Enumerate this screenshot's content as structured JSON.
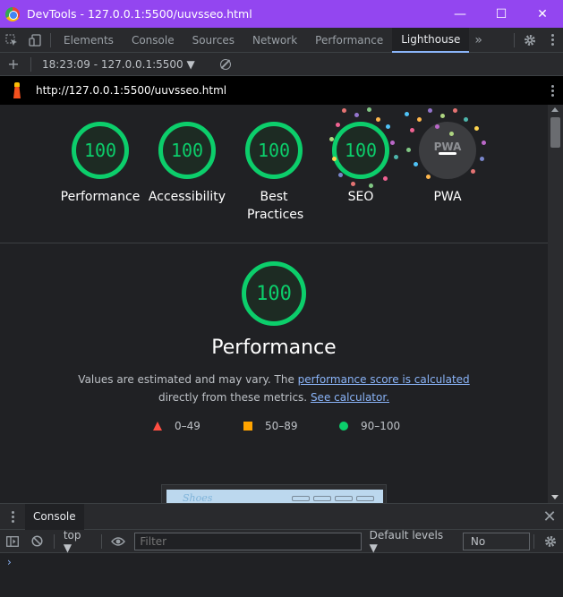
{
  "window": {
    "title": "DevTools - 127.0.0.1:5500/uuvsseo.html",
    "controls": {
      "minimize": "—",
      "maximize": "☐",
      "close": "✕"
    }
  },
  "tabs": {
    "items": [
      "Elements",
      "Console",
      "Sources",
      "Network",
      "Performance",
      "Lighthouse"
    ],
    "active": "Lighthouse",
    "more": "»"
  },
  "lighthouse_toolbar": {
    "add": "+",
    "report_select": "18:23:09 - 127.0.0.1:5500 ▼"
  },
  "urlbar": {
    "url": "http://127.0.0.1:5500/uuvsseo.html"
  },
  "gauges": [
    {
      "score": "100",
      "label": "Performance"
    },
    {
      "score": "100",
      "label": "Accessibility"
    },
    {
      "score": "100",
      "label": "Best Practices"
    },
    {
      "score": "100",
      "label": "SEO"
    }
  ],
  "pwa": {
    "badge_text": "PWA",
    "label": "PWA"
  },
  "category": {
    "score": "100",
    "title": "Performance",
    "desc_prefix": "Values are estimated and may vary. The ",
    "desc_link1": "performance score is calculated",
    "desc_middle": "directly from these metrics. ",
    "desc_link2": "See calculator."
  },
  "legend": {
    "fail": "0–49",
    "average": "50–89",
    "pass": "90–100"
  },
  "colors": {
    "pass": "#0cce6b",
    "average": "#ffa400",
    "fail": "#ff4e42",
    "accent": "#9346f0",
    "link": "#8ab4f8"
  },
  "drawer": {
    "tab": "Console",
    "context": "top ▼",
    "filter_placeholder": "Filter",
    "levels": "Default levels ▼",
    "issues": "No Issues",
    "prompt": "›"
  }
}
